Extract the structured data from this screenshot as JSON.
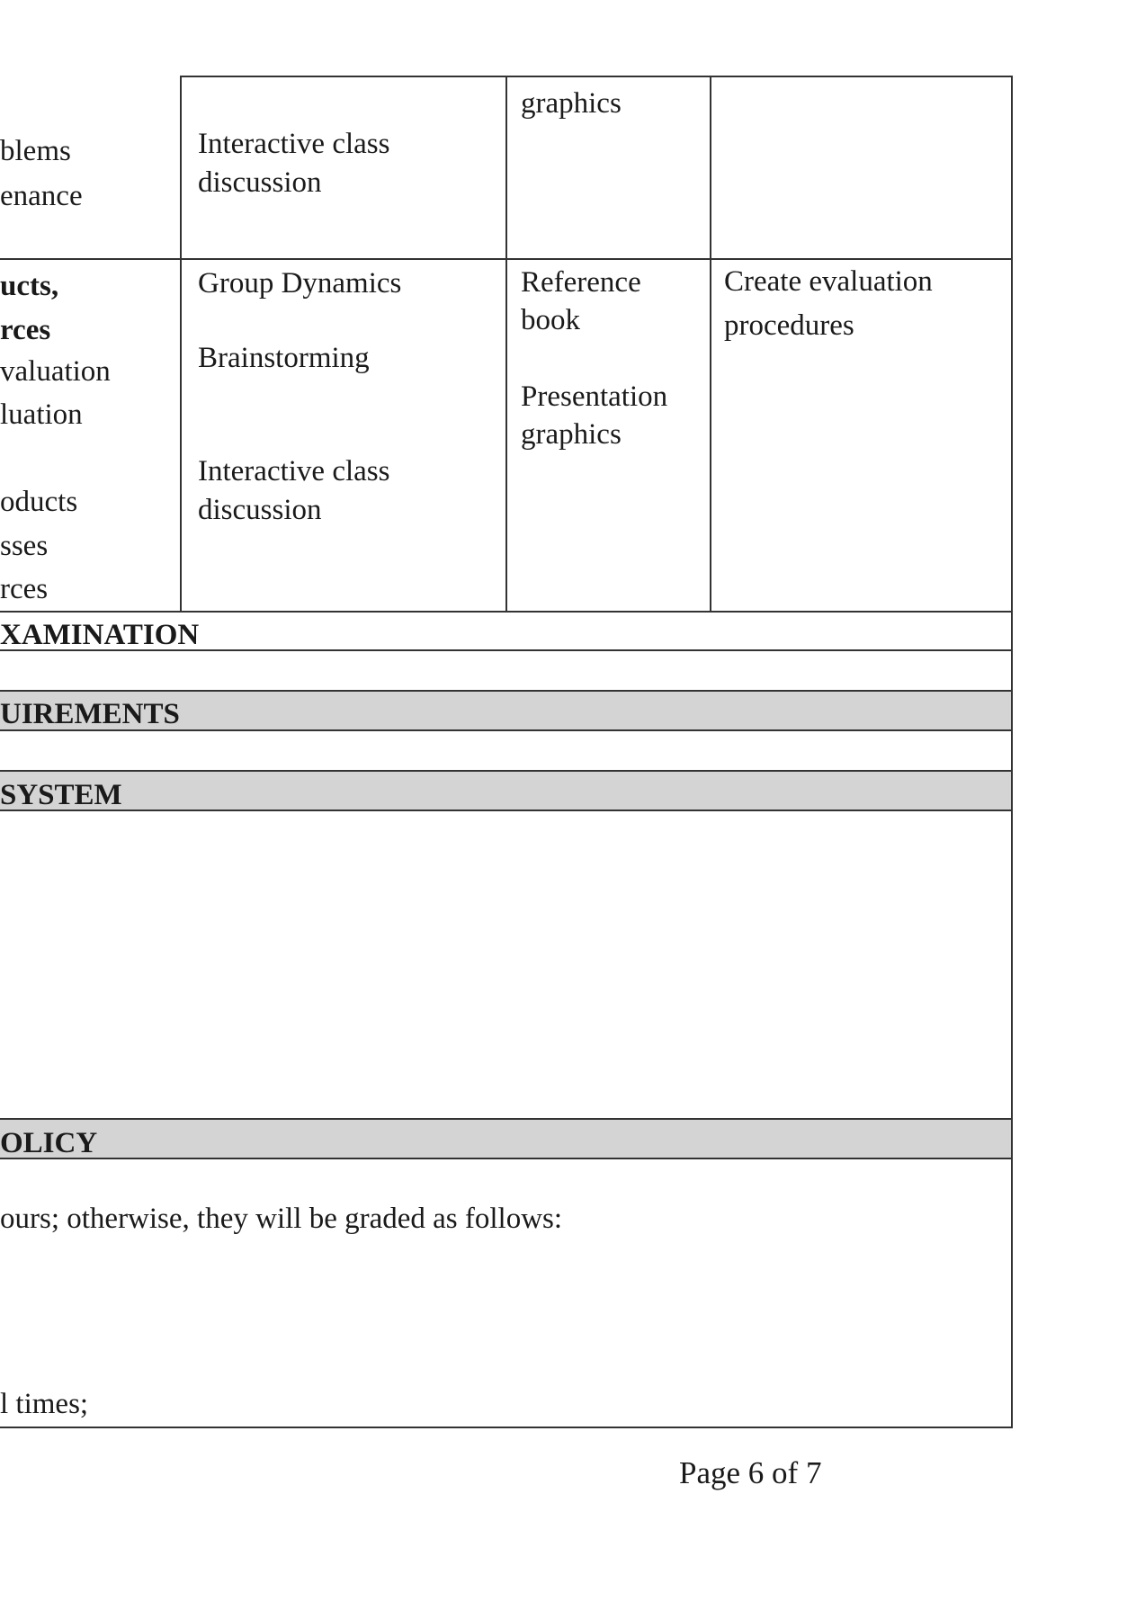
{
  "top_row": {
    "col1_lines": [
      "blems",
      "enance"
    ],
    "col2_lines": [
      "Interactive class",
      "discussion"
    ],
    "col3_lines": [
      "graphics"
    ],
    "col4_lines": []
  },
  "second_row": {
    "col1_bold_lines": [
      "ucts,",
      "rces"
    ],
    "col1_lines": [
      "valuation",
      "luation",
      "oducts",
      "sses",
      "rces"
    ],
    "col2_items": [
      "Group Dynamics",
      "Brainstorming",
      "Interactive class",
      "discussion"
    ],
    "col3_items": [
      "Reference",
      "book",
      "Presentation",
      "graphics"
    ],
    "col4_lines": [
      "Create evaluation",
      "procedures"
    ]
  },
  "sections": {
    "examination": "XAMINATION",
    "requirements": "UIREMENTS",
    "system": "SYSTEM",
    "policy": "OLICY"
  },
  "policy_text": {
    "line1": "ours; otherwise, they will be graded as follows:",
    "line2": "l times;"
  },
  "footer": {
    "page_number": "Page 6 of 7"
  }
}
